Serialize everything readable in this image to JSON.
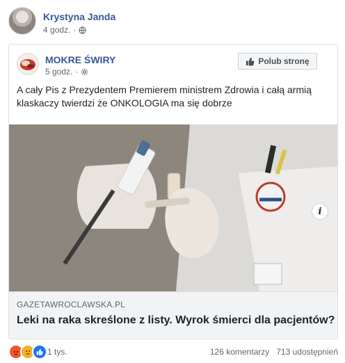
{
  "post": {
    "author": "Krystyna Janda",
    "time": "4 godz.",
    "visibility_icon": "globe-icon"
  },
  "shared": {
    "page_name": "MOKRE ŚWIRY",
    "time": "5 godz.",
    "visibility_icon": "gear-icon",
    "like_page_label": "Polub stronę",
    "text": "A cały Pis z Prezydentem Premierem ministrem Zdrowia i całą armią klaskaczy twierdzi że ONKOLOGIA ma się dobrze",
    "link": {
      "domain": "GAZETAWROCLAWSKA.PL",
      "title": "Leki na raka skreślone z listy. Wyrok śmierci dla pacjentów?",
      "info_label": "i"
    }
  },
  "footer": {
    "reactions_count": "1 tys.",
    "comments": "126 komentarzy",
    "shares": "713 udostępnień"
  },
  "colors": {
    "link_blue": "#385898",
    "angry": "#f0552a",
    "sad": "#f7b125",
    "like": "#1877f2"
  }
}
